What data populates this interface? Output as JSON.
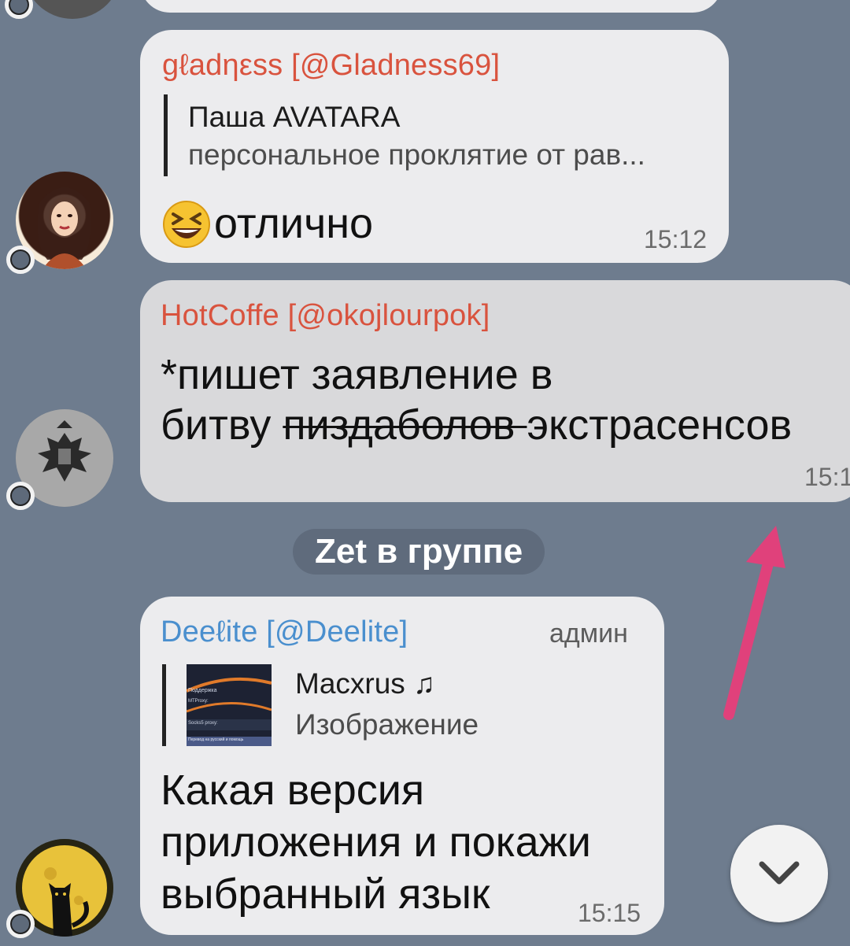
{
  "messages": [
    {
      "sender": "gℓadηεss [@Gladness69]",
      "sender_color": "#d9533e",
      "reply": {
        "name": "Паша AVATARA",
        "text": "персональное проклятие от рав..."
      },
      "emoji": "laughing-emoji",
      "text": "отлично",
      "time": "15:12"
    },
    {
      "sender": "HotCoffe [@okojlourpok]",
      "sender_color": "#d9533e",
      "line1": "*пишет заявление в",
      "line2_prefix": "битву ",
      "line2_struck": "пиздаболов ",
      "line2_suffix": "экстрасенсов",
      "time": "15:1"
    },
    {
      "sender": "Deeℓite [@Deelite]",
      "sender_color": "#4a8fce",
      "badge": "админ",
      "reply": {
        "name": "Macxrus ♫",
        "text": "Изображение"
      },
      "thumb_lines": [
        "Поддержка",
        "MTProxy:",
        "Socks5 proxy:",
        "Перевод на русский и помощь"
      ],
      "line1": "Какая версия",
      "line2": "приложения и покажи",
      "line3": "выбранный язык",
      "time": "15:15"
    }
  ],
  "service_message": "Zet в группе",
  "colors": {
    "background": "#6e7c8e",
    "bubble": "#ececee",
    "arrow": "#e0417b"
  },
  "icons": [
    "chevron-down-icon",
    "arrow-annotation"
  ]
}
